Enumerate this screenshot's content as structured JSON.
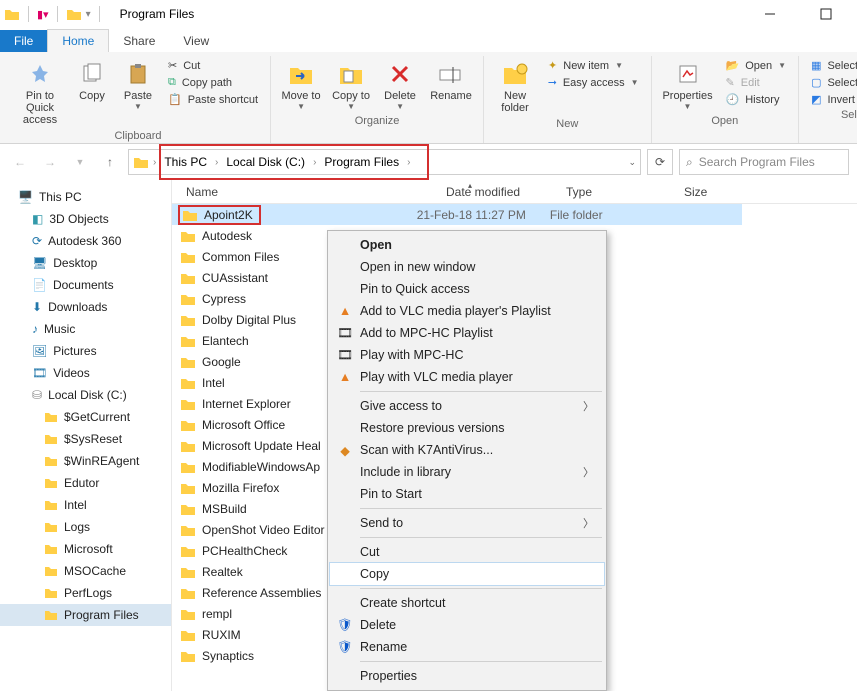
{
  "window": {
    "title": "Program Files"
  },
  "ribbon": {
    "tabs": {
      "file": "File",
      "home": "Home",
      "share": "Share",
      "view": "View"
    },
    "clipboard": {
      "label": "Clipboard",
      "pin": "Pin to Quick access",
      "copy": "Copy",
      "paste": "Paste",
      "cut": "Cut",
      "copy_path": "Copy path",
      "paste_shortcut": "Paste shortcut"
    },
    "organize": {
      "label": "Organize",
      "move_to": "Move to",
      "copy_to": "Copy to",
      "delete": "Delete",
      "rename": "Rename"
    },
    "new": {
      "label": "New",
      "new_folder": "New folder",
      "new_item": "New item",
      "easy_access": "Easy access"
    },
    "open": {
      "label": "Open",
      "properties": "Properties",
      "open": "Open",
      "edit": "Edit",
      "history": "History"
    },
    "select": {
      "label": "Select",
      "select_all": "Select all",
      "select_none": "Select none",
      "invert": "Invert selection"
    }
  },
  "breadcrumb": {
    "seg0": "This PC",
    "seg1": "Local Disk (C:)",
    "seg2": "Program Files"
  },
  "search": {
    "placeholder": "Search Program Files"
  },
  "columns": {
    "name": "Name",
    "date": "Date modified",
    "type": "Type",
    "size": "Size"
  },
  "sidebar": {
    "this_pc": "This PC",
    "objects3d": "3D Objects",
    "autodesk360": "Autodesk 360",
    "desktop": "Desktop",
    "documents": "Documents",
    "downloads": "Downloads",
    "music": "Music",
    "pictures": "Pictures",
    "videos": "Videos",
    "local_disk": "Local Disk (C:)",
    "getcurrent": "$GetCurrent",
    "sysreset": "$SysReset",
    "winreagent": "$WinREAgent",
    "edutor": "Edutor",
    "intel": "Intel",
    "logs": "Logs",
    "microsoft": "Microsoft",
    "msocache": "MSOCache",
    "perflogs": "PerfLogs",
    "program_files": "Program Files"
  },
  "folders": [
    "Apoint2K",
    "Autodesk",
    "Common Files",
    "CUAssistant",
    "Cypress",
    "Dolby Digital Plus",
    "Elantech",
    "Google",
    "Intel",
    "Internet Explorer",
    "Microsoft Office",
    "Microsoft Update Heal",
    "ModifiableWindowsAp",
    "Mozilla Firefox",
    "MSBuild",
    "OpenShot Video Editor",
    "PCHealthCheck",
    "Realtek",
    "Reference Assemblies",
    "rempl",
    "RUXIM",
    "Synaptics"
  ],
  "selected_row_meta": {
    "date": "21-Feb-18 11:27 PM",
    "type": "File folder"
  },
  "context_menu": {
    "open": "Open",
    "open_new": "Open in new window",
    "pin_qa": "Pin to Quick access",
    "vlc_playlist": "Add to VLC media player's Playlist",
    "mpc_playlist": "Add to MPC-HC Playlist",
    "play_mpc": "Play with MPC-HC",
    "play_vlc": "Play with VLC media player",
    "give_access": "Give access to",
    "restore_prev": "Restore previous versions",
    "scan_k7": "Scan with K7AntiVirus...",
    "include_lib": "Include in library",
    "pin_start": "Pin to Start",
    "send_to": "Send to",
    "cut": "Cut",
    "copy": "Copy",
    "create_shortcut": "Create shortcut",
    "delete": "Delete",
    "rename": "Rename",
    "properties": "Properties"
  }
}
